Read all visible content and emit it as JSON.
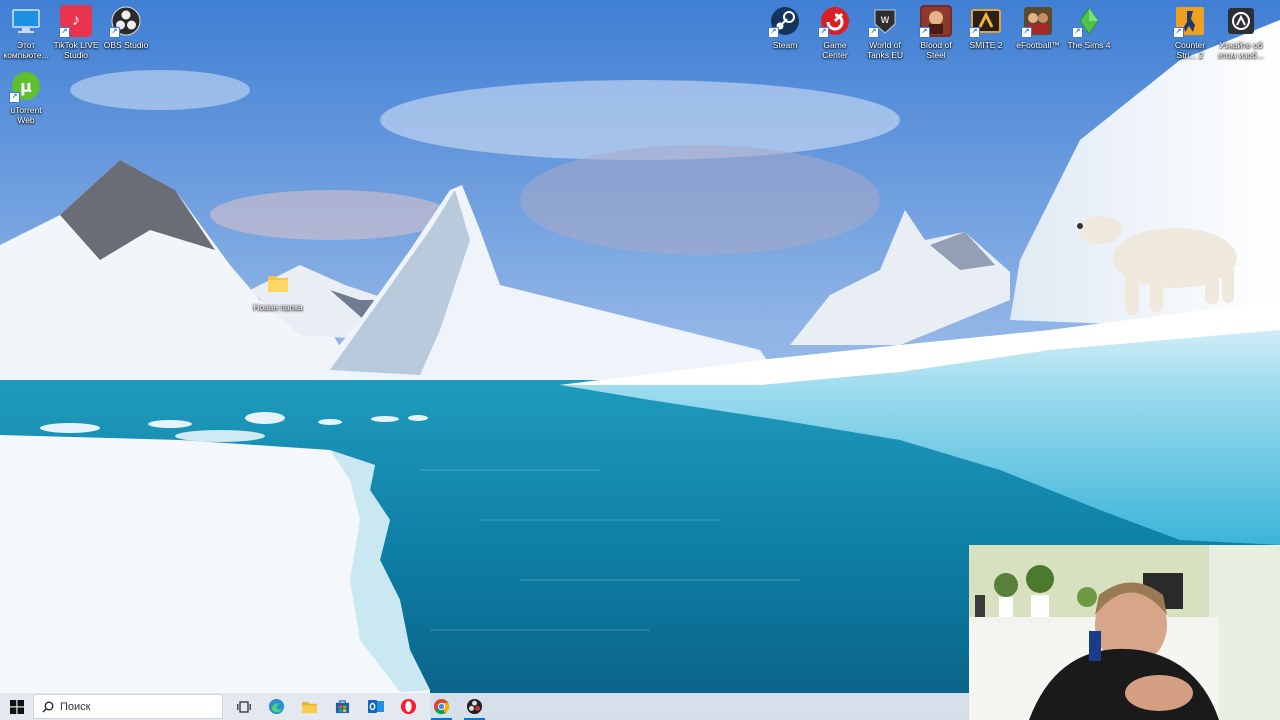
{
  "desktop_icons": {
    "this_pc": "Этот компьюте...",
    "tiktok": "TikTok LIVE Studio",
    "obs": "OBS Studio",
    "utorrent": "uTorrent Web",
    "new_folder": "Новая папка",
    "steam": "Steam",
    "game_center": "Game Center",
    "wot": "World of Tanks EU",
    "blood_of_steel": "Blood of Steel",
    "smite": "SMITE 2",
    "efootball": "eFootball™",
    "sims": "The Sims 4",
    "cs2": "Counter Stri... 2",
    "learn": "Узнайте об этом изоб..."
  },
  "taskbar": {
    "search_placeholder": "Поиск"
  },
  "colors": {
    "taskbar_bg": "#e2e8f0",
    "accent": "#0078d7"
  }
}
